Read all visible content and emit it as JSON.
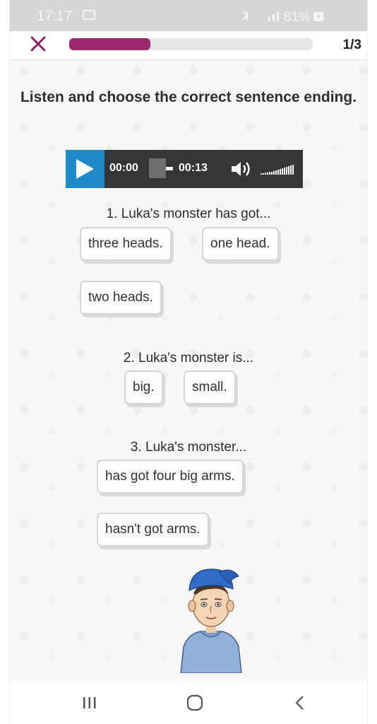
{
  "status_bar": {
    "time": "17:17",
    "right_text": " ·· 81%"
  },
  "topbar": {
    "close_icon": "close-x-icon",
    "progress_fraction": 0.333,
    "counter": "1/3",
    "accent_color": "#9c2a6e"
  },
  "question_title": "Listen and choose the correct sentence ending.",
  "audio": {
    "current_time": "00:00",
    "total_time": "00:13",
    "play_icon": "play-icon",
    "volume_icon": "speaker-icon"
  },
  "questions": [
    {
      "label": "1. Luka's monster has got...",
      "options": [
        "three heads.",
        "one head.",
        "two heads."
      ]
    },
    {
      "label": "2. Luka's monster is...",
      "options": [
        "big.",
        "small."
      ]
    },
    {
      "label": "3. Luka's monster...",
      "options": [
        "has got four big arms.",
        "hasn't got arms."
      ]
    }
  ],
  "nav": {
    "recents_icon": "recents-icon",
    "home_icon": "home-icon",
    "back_icon": "back-icon"
  }
}
